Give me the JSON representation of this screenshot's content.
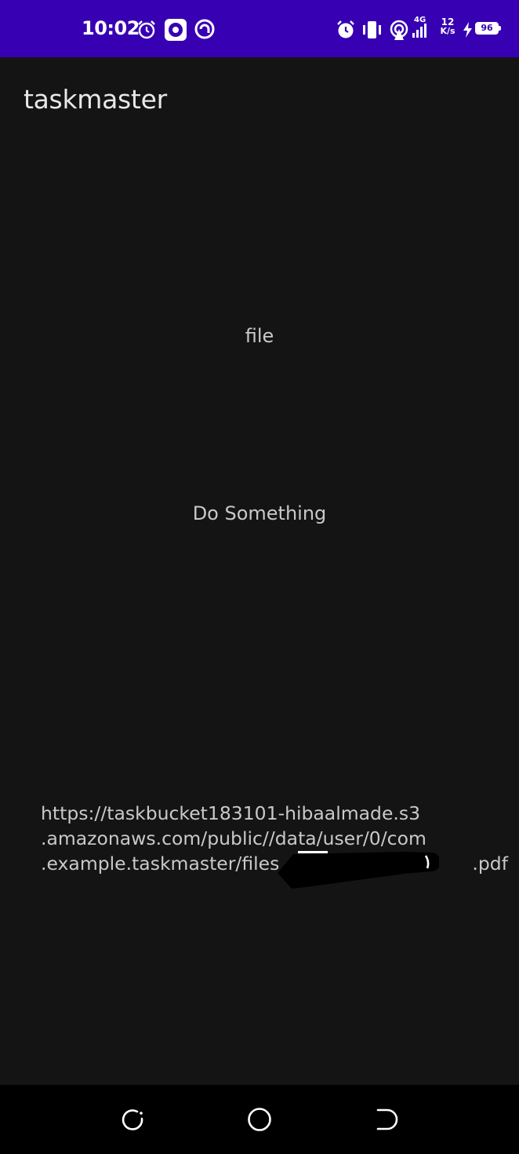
{
  "status_bar": {
    "time": "10:02",
    "network_type": "4G",
    "speed_value": "12",
    "speed_unit": "K/s",
    "battery": "96",
    "icons_left": [
      "alarm-icon",
      "record-icon",
      "at-icon"
    ],
    "icons_right": [
      "alarm-icon",
      "vibrate-icon",
      "hotspot-icon",
      "signal-icon",
      "charging-icon",
      "battery-icon"
    ]
  },
  "app_bar": {
    "title": "taskmaster"
  },
  "main": {
    "file_label": "file",
    "action_button_label": "Do Something",
    "url_lines": [
      "https://taskbucket183101-hibaalmade.s3",
      ".amazonaws.com/public//data/user/0/com",
      ".example.taskmaster/files",
      ".pdf"
    ]
  },
  "nav_bar": {
    "icons": [
      "recent-apps-icon",
      "home-icon",
      "back-icon"
    ]
  },
  "colors": {
    "status_bar_bg": "#3700b3",
    "app_bg": "#141414",
    "nav_bg": "#000000",
    "text_primary": "#e8e8e8",
    "text_secondary": "#c9c9c9"
  }
}
